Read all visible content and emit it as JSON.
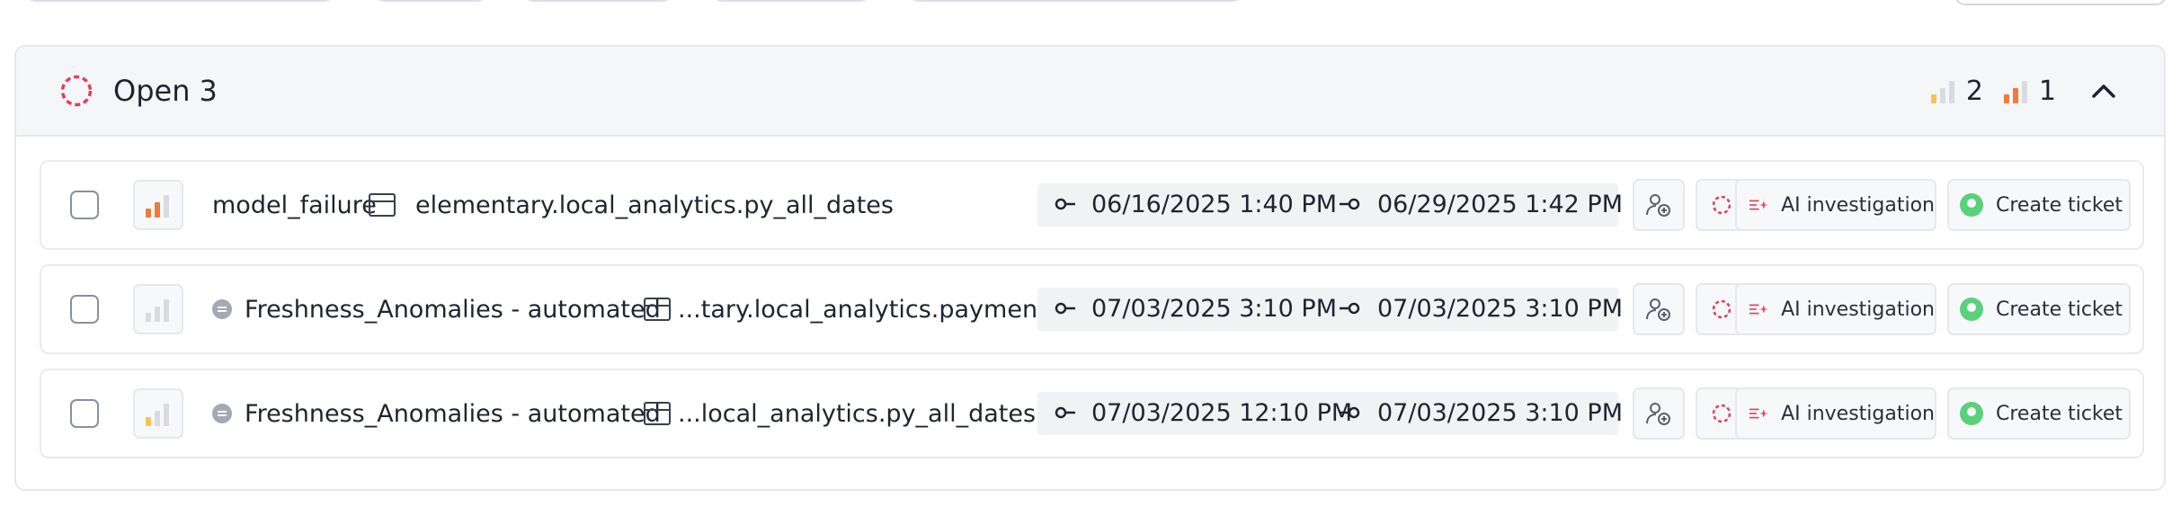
{
  "group": {
    "title": "Open",
    "count": "3",
    "severity_summary": [
      {
        "level": "low",
        "count": "2",
        "color": "#f5c454"
      },
      {
        "level": "high",
        "count": "1",
        "color": "#ef7a3a"
      }
    ],
    "status_color": "#e0425b"
  },
  "incidents": [
    {
      "severity": "high",
      "automated": false,
      "name": "model_failure",
      "table": "elementary.local_analytics.py_all_dates",
      "first_seen": "06/16/2025 1:40 PM",
      "last_seen": "06/29/2025 1:42 PM",
      "ai_label": "AI investigation",
      "ticket_label": "Create ticket"
    },
    {
      "severity": "none",
      "automated": true,
      "name": "Freshness_Anomalies - automated",
      "table": "...tary.local_analytics.payment",
      "first_seen": "07/03/2025 3:10 PM",
      "last_seen": "07/03/2025 3:10 PM",
      "ai_label": "AI investigation",
      "ticket_label": "Create ticket"
    },
    {
      "severity": "low",
      "automated": true,
      "name": "Freshness_Anomalies - automated",
      "table": "...local_analytics.py_all_dates",
      "first_seen": "07/03/2025 12:10 PM",
      "last_seen": "07/03/2025 3:10 PM",
      "ai_label": "AI investigation",
      "ticket_label": "Create ticket"
    }
  ],
  "colors": {
    "accent_red": "#e0425b",
    "sev_high": "#ef7a3a",
    "sev_low": "#f5c454",
    "sev_empty": "#d9dbe0",
    "ticket_green": "#5bd07b"
  }
}
